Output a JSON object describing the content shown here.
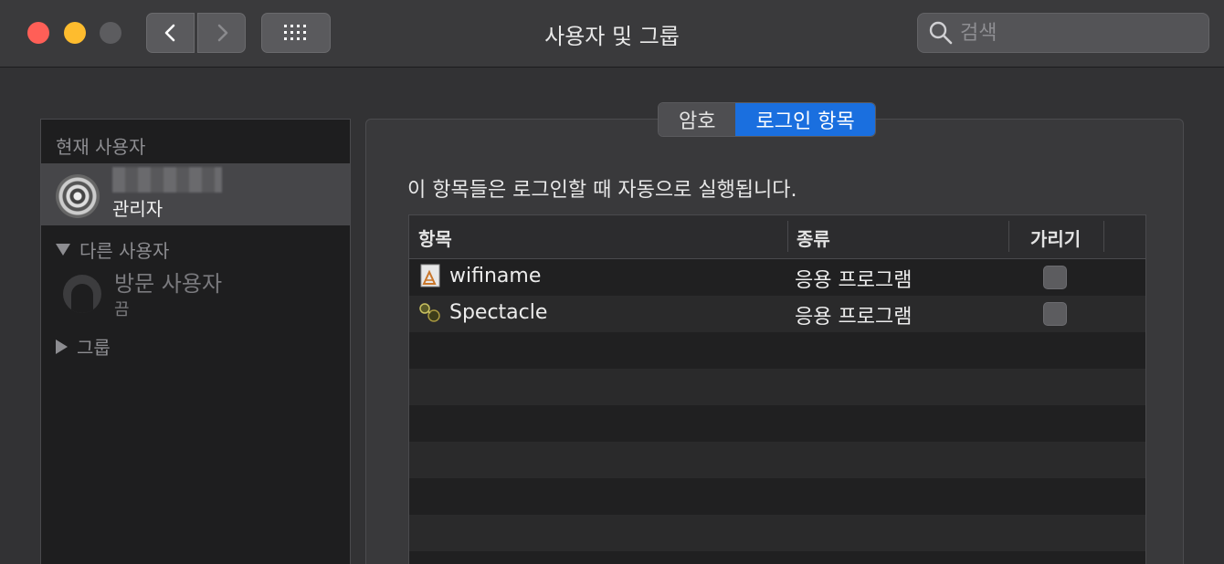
{
  "window": {
    "title": "사용자 및 그룹"
  },
  "search": {
    "placeholder": "검색",
    "value": ""
  },
  "sidebar": {
    "current_user_header": "현재 사용자",
    "current_user": {
      "role": "관리자"
    },
    "other_users_header": "다른 사용자",
    "guest": {
      "name": "방문 사용자",
      "status": "끔"
    },
    "groups_label": "그룹"
  },
  "tabs": [
    {
      "label": "암호",
      "active": false
    },
    {
      "label": "로그인 항목",
      "active": true
    }
  ],
  "login_items": {
    "description": "이 항목들은 로그인할 때 자동으로 실행됩니다.",
    "columns": [
      "항목",
      "종류",
      "가리기"
    ],
    "rows": [
      {
        "name": "wifiname",
        "kind": "응용 프로그램",
        "hide": false,
        "icon": "script-app-icon"
      },
      {
        "name": "Spectacle",
        "kind": "응용 프로그램",
        "hide": false,
        "icon": "spectacle-app-icon"
      }
    ]
  },
  "colors": {
    "accent": "#1a6fdf",
    "close": "#ff5f57",
    "minimize": "#febc2e"
  }
}
